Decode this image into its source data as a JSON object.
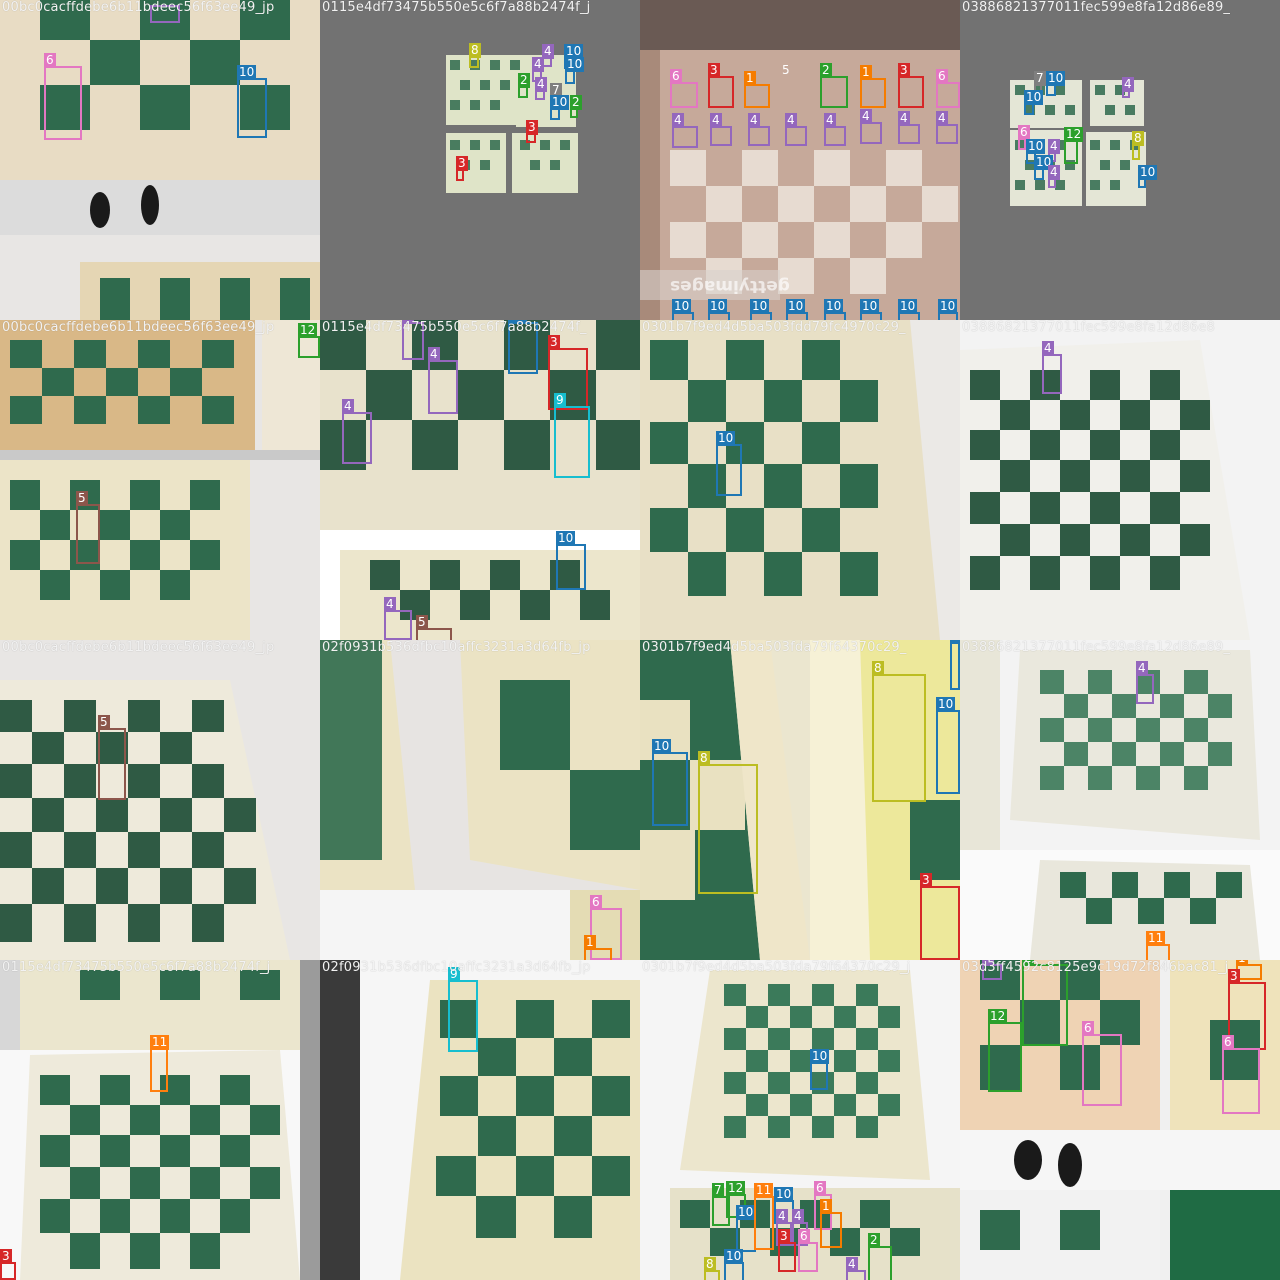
{
  "colors": {
    "1": "#f57c00",
    "2": "#2ca02c",
    "3": "#d62728",
    "4": "#9467bd",
    "5": "#8c564b",
    "6": "#e377c2",
    "7": "#7f7f7f",
    "8": "#bcbd22",
    "9": "#17becf",
    "10": "#1f77b4",
    "11": "#ff7f0e",
    "12": "#2ca02c"
  },
  "tiles": [
    {
      "name": "00bc0cacffdebe6b11bdeec56f63ee49_jp",
      "bg": "green-board"
    },
    {
      "name": "0115e4df73475b550e5c6f7a88b2474f_j",
      "bg": "gray-mosaic"
    },
    {
      "name": "",
      "bg": "wood-board",
      "watermark": "gettyimages"
    },
    {
      "name": "03886821377011fec599e8fa12d86e89_",
      "bg": "gray-mosaic"
    },
    {
      "name": "00bc0cacffdebe6b11bdeec56f63ee49_jp",
      "bg": "green-board"
    },
    {
      "name": "0115e4df73475b550e5c6f7a88b2474f_",
      "bg": "green-board"
    },
    {
      "name": "0301b7f9ed4d5ba503fdd79fc4970c29_",
      "bg": "green-board"
    },
    {
      "name": "03886821377011fec599e8fa12d86e8",
      "bg": "green-board"
    },
    {
      "name": "00bc0cacffdebe6b11bdeec56f63ee49_jp",
      "bg": "green-board"
    },
    {
      "name": "02f0931b536dfbc10affc3231a3d64fb_jp",
      "bg": "green-board"
    },
    {
      "name": "0301b7f9ed4d5ba503fda79f64370c29_",
      "bg": "green-board"
    },
    {
      "name": "03886821377011fec599e8fa12d86e89_",
      "bg": "green-board"
    },
    {
      "name": "0115e4df73475b550e5c6f7a88b2474f_j",
      "bg": "green-board"
    },
    {
      "name": "02f0931b536dfbc10affc3231a3d64fb_jp",
      "bg": "green-board"
    },
    {
      "name": "0301b7f9ed4d5ba503fda79f64370c29_j",
      "bg": "green-board"
    },
    {
      "name": "03d3ff4592c8125e9c19d72f846bac81_j",
      "bg": "green-board"
    }
  ]
}
